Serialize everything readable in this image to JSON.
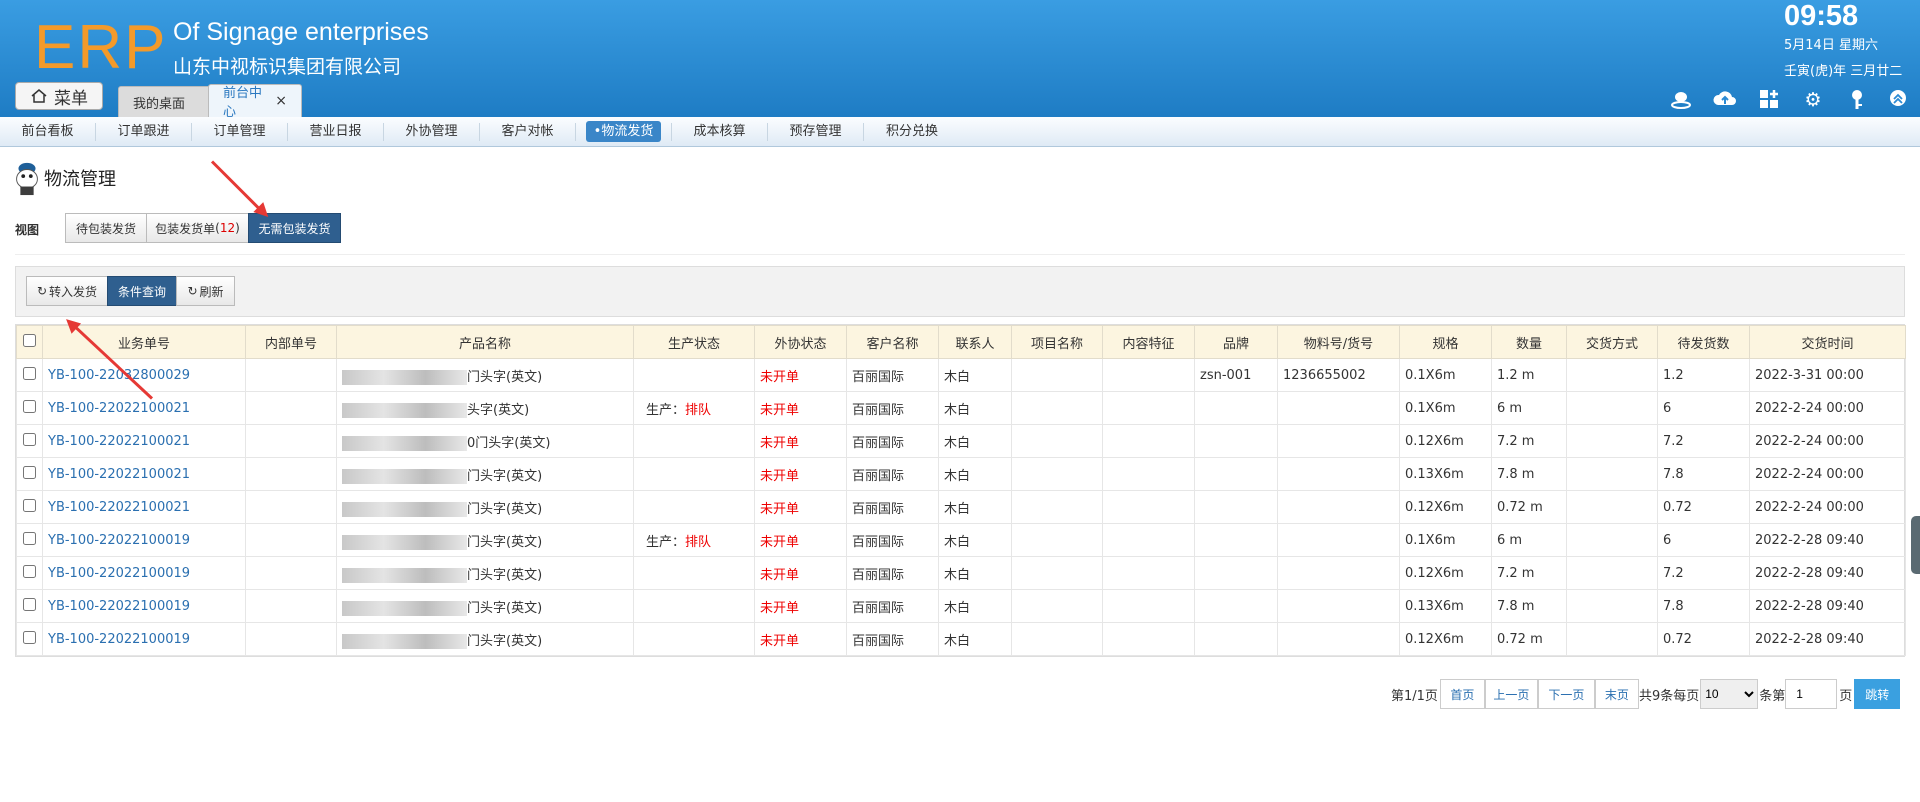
{
  "header": {
    "logo": "ERP",
    "company_en": "Of Signage enterprises",
    "company_cn": "山东中视标识集团有限公司",
    "time": "09:58",
    "date": "5月14日 星期六",
    "lunar": "壬寅(虎)年 三月廿二",
    "menu_label": "菜单",
    "tabs": [
      {
        "label": "我的桌面"
      },
      {
        "label": "前台中心",
        "close": "×"
      }
    ]
  },
  "nav": {
    "items": [
      "前台看板",
      "订单跟进",
      "订单管理",
      "营业日报",
      "外协管理",
      "客户对帐",
      "•物流发货",
      "成本核算",
      "预存管理",
      "积分兑换"
    ]
  },
  "page": {
    "title": "物流管理",
    "view_label": "视图",
    "view_buttons": [
      {
        "label": "待包装发货"
      },
      {
        "label": "包装发货单",
        "count_open": "(",
        "count": "12",
        "count_close": ")"
      },
      {
        "label": "无需包装发货"
      }
    ],
    "toolbar": {
      "transfer": "转入发货",
      "query": "条件查询",
      "refresh": "刷新"
    }
  },
  "table": {
    "columns": [
      "业务单号",
      "内部单号",
      "产品名称",
      "生产状态",
      "外协状态",
      "客户名称",
      "联系人",
      "项目名称",
      "内容特征",
      "品牌",
      "物料号/货号",
      "规格",
      "数量",
      "交货方式",
      "待发货数",
      "交货时间"
    ],
    "rows": [
      {
        "order": "YB-100-22032800029",
        "inner": "",
        "product": "门头字(英文)",
        "prod_status_label": "",
        "prod_status": "",
        "outsource": "未开单",
        "customer": "百丽国际",
        "contact": "木白",
        "project": "",
        "content": "",
        "brand": "zsn-001",
        "material": "1236655002",
        "spec": "0.1X6m",
        "qty": "1.2 m",
        "delivery": "",
        "pending": "1.2",
        "due": "2022-3-31 00:00"
      },
      {
        "order": "YB-100-22022100021",
        "inner": "",
        "product": "头字(英文)",
        "prod_status_label": "生产：",
        "prod_status": "排队",
        "outsource": "未开单",
        "customer": "百丽国际",
        "contact": "木白",
        "project": "",
        "content": "",
        "brand": "",
        "material": "",
        "spec": "0.1X6m",
        "qty": "6 m",
        "delivery": "",
        "pending": "6",
        "due": "2022-2-24 00:00"
      },
      {
        "order": "YB-100-22022100021",
        "inner": "",
        "product": "0门头字(英文)",
        "prod_status_label": "",
        "prod_status": "",
        "outsource": "未开单",
        "customer": "百丽国际",
        "contact": "木白",
        "project": "",
        "content": "",
        "brand": "",
        "material": "",
        "spec": "0.12X6m",
        "qty": "7.2 m",
        "delivery": "",
        "pending": "7.2",
        "due": "2022-2-24 00:00"
      },
      {
        "order": "YB-100-22022100021",
        "inner": "",
        "product": "门头字(英文)",
        "prod_status_label": "",
        "prod_status": "",
        "outsource": "未开单",
        "customer": "百丽国际",
        "contact": "木白",
        "project": "",
        "content": "",
        "brand": "",
        "material": "",
        "spec": "0.13X6m",
        "qty": "7.8 m",
        "delivery": "",
        "pending": "7.8",
        "due": "2022-2-24 00:00"
      },
      {
        "order": "YB-100-22022100021",
        "inner": "",
        "product": "门头字(英文)",
        "prod_status_label": "",
        "prod_status": "",
        "outsource": "未开单",
        "customer": "百丽国际",
        "contact": "木白",
        "project": "",
        "content": "",
        "brand": "",
        "material": "",
        "spec": "0.12X6m",
        "qty": "0.72 m",
        "delivery": "",
        "pending": "0.72",
        "due": "2022-2-24 00:00"
      },
      {
        "order": "YB-100-22022100019",
        "inner": "",
        "product": "门头字(英文)",
        "prod_status_label": "生产：",
        "prod_status": "排队",
        "outsource": "未开单",
        "customer": "百丽国际",
        "contact": "木白",
        "project": "",
        "content": "",
        "brand": "",
        "material": "",
        "spec": "0.1X6m",
        "qty": "6 m",
        "delivery": "",
        "pending": "6",
        "due": "2022-2-28 09:40"
      },
      {
        "order": "YB-100-22022100019",
        "inner": "",
        "product": "门头字(英文)",
        "prod_status_label": "",
        "prod_status": "",
        "outsource": "未开单",
        "customer": "百丽国际",
        "contact": "木白",
        "project": "",
        "content": "",
        "brand": "",
        "material": "",
        "spec": "0.12X6m",
        "qty": "7.2 m",
        "delivery": "",
        "pending": "7.2",
        "due": "2022-2-28 09:40"
      },
      {
        "order": "YB-100-22022100019",
        "inner": "",
        "product": "门头字(英文)",
        "prod_status_label": "",
        "prod_status": "",
        "outsource": "未开单",
        "customer": "百丽国际",
        "contact": "木白",
        "project": "",
        "content": "",
        "brand": "",
        "material": "",
        "spec": "0.13X6m",
        "qty": "7.8 m",
        "delivery": "",
        "pending": "7.8",
        "due": "2022-2-28 09:40"
      },
      {
        "order": "YB-100-22022100019",
        "inner": "",
        "product": "门头字(英文)",
        "prod_status_label": "",
        "prod_status": "",
        "outsource": "未开单",
        "customer": "百丽国际",
        "contact": "木白",
        "project": "",
        "content": "",
        "brand": "",
        "material": "",
        "spec": "0.12X6m",
        "qty": "0.72 m",
        "delivery": "",
        "pending": "0.72",
        "due": "2022-2-28 09:40"
      }
    ]
  },
  "pager": {
    "page_info": "第1/1页",
    "first": "首页",
    "prev": "上一页",
    "next": "下一页",
    "last": "末页",
    "total_info": "共9条每页",
    "page_size": "10",
    "page_size_options": [
      "10"
    ],
    "goto_label": "条第",
    "goto_value": "1",
    "page_suffix": "页",
    "jump": "跳转"
  },
  "colors": {
    "header": "#2a8ad4",
    "accent": "#2f5f8f",
    "link": "#2a6fb0",
    "alert": "#e00000",
    "arrow": "#e53935",
    "logo": "#f39a2a"
  }
}
